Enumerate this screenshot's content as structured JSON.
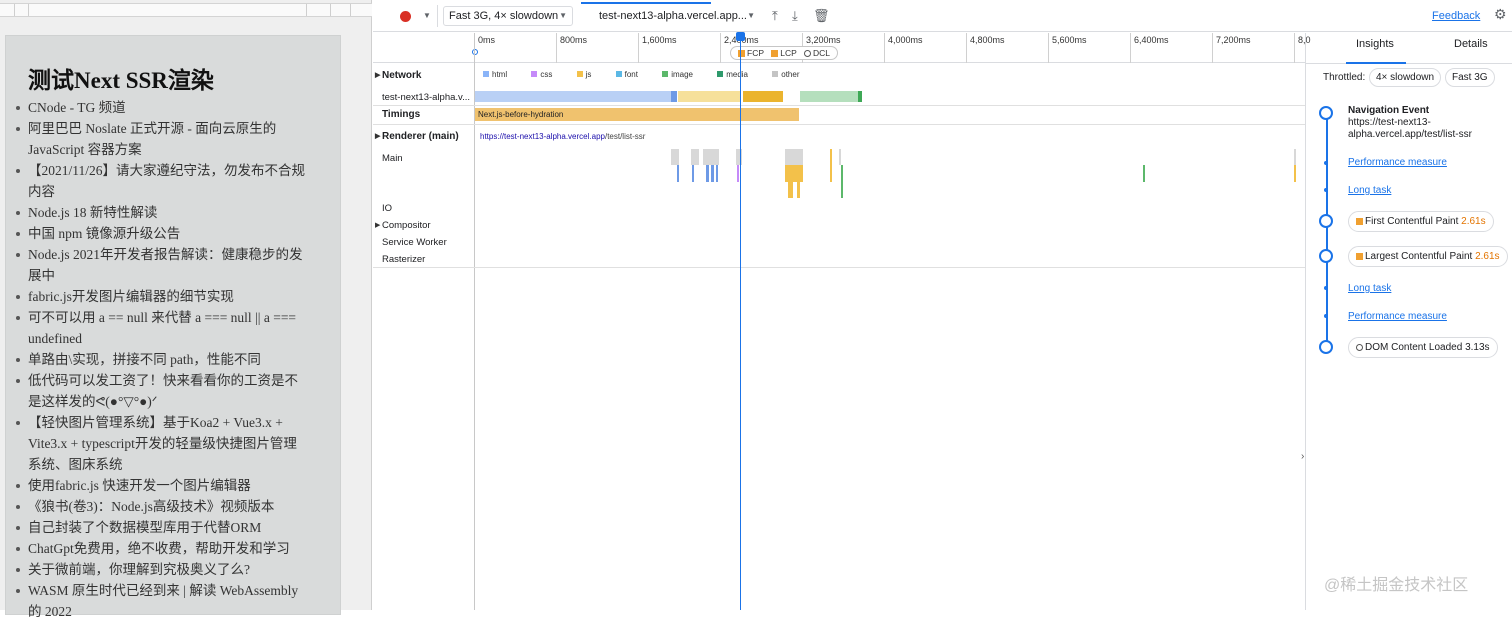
{
  "page": {
    "title": "测试Next SSR渲染",
    "items": [
      "CNode - TG 频道",
      "阿里巴巴 Noslate 正式开源 - 面向云原生的 JavaScript 容器方案",
      "【2021/11/26】请大家遵纪守法，勿发布不合规内容",
      "Node.js 18 新特性解读",
      "中国 npm 镜像源升级公告",
      "Node.js 2021年开发者报告解读：健康稳步的发展中",
      "fabric.js开发图片编辑器的细节实现",
      "可不可以用 a == null 来代替 a === null || a === undefined",
      "单路由\\实现，拼接不同 path，性能不同",
      "低代码可以发工资了！快来看看你的工资是不是这样发的ᕙ(●°▽°●)ᐟ",
      "【轻快图片管理系统】基于Koa2 + Vue3.x + Vite3.x + typescript开发的轻量级快捷图片管理系统、图床系统",
      "使用fabric.js 快速开发一个图片编辑器",
      "《狼书(卷3)：Node.js高级技术》视频版本",
      "自己封装了个数据模型库用于代替ORM",
      "ChatGpt免费用，绝不收费，帮助开发和学习",
      "关于微前端，你理解到究极奥义了么?",
      "WASM 原生时代已经到来 | 解读 WebAssembly 的 2022"
    ]
  },
  "toolbar": {
    "throttle_select": "Fast 3G, 4× slowdown",
    "recording_select": "test-next13-alpha.vercel.app...",
    "feedback": "Feedback"
  },
  "ruler": {
    "ticks": [
      "0ms",
      "800ms",
      "1,600ms",
      "2,400ms",
      "3,200ms",
      "4,000ms",
      "4,800ms",
      "5,600ms",
      "6,400ms",
      "7,200ms",
      "8,0"
    ],
    "markers": {
      "fcp": "FCP",
      "lcp": "LCP",
      "dcl": "DCL"
    }
  },
  "tracks": {
    "network": "Network",
    "network_row": "test-next13-alpha.v...",
    "legend": [
      "html",
      "css",
      "js",
      "font",
      "image",
      "media",
      "other"
    ],
    "timings": "Timings",
    "timing_label": "Next.js-before-hydration",
    "renderer": "Renderer (main)",
    "renderer_url": "https://test-next13-alpha.vercel.app",
    "renderer_path": "/test/list-ssr",
    "main": "Main",
    "io": "IO",
    "compositor": "Compositor",
    "service_worker": "Service Worker",
    "rasterizer": "Rasterizer"
  },
  "panel": {
    "tabs": [
      "Insights",
      "Details"
    ],
    "throttled_label": "Throttled:",
    "cpu_chip": "4× slowdown",
    "net_chip": "Fast 3G",
    "nav_title": "Navigation Event",
    "nav_url_1": "https://test-next13-",
    "nav_url_2": "alpha.vercel.app/test/list-ssr",
    "perf1": "Performance measure",
    "long1": "Long task",
    "fcp_label": "First Contentful Paint",
    "fcp_time": "2.61s",
    "lcp_label": "Largest Contentful Paint",
    "lcp_time": "2.61s",
    "long2": "Long task",
    "perf2": "Performance measure",
    "dcl_label": "DOM Content Loaded",
    "dcl_time": "3.13s"
  },
  "watermark": "@稀土掘金技术社区",
  "colors": {
    "html": "#8ab4f8",
    "css": "#c58af9",
    "js": "#f3c14a",
    "font": "#5bb8e5",
    "image": "#5cb86b",
    "media": "#2e9a6c",
    "other": "#c4c4c4",
    "timing": "#f0c26e",
    "accent": "#1a73e8"
  }
}
